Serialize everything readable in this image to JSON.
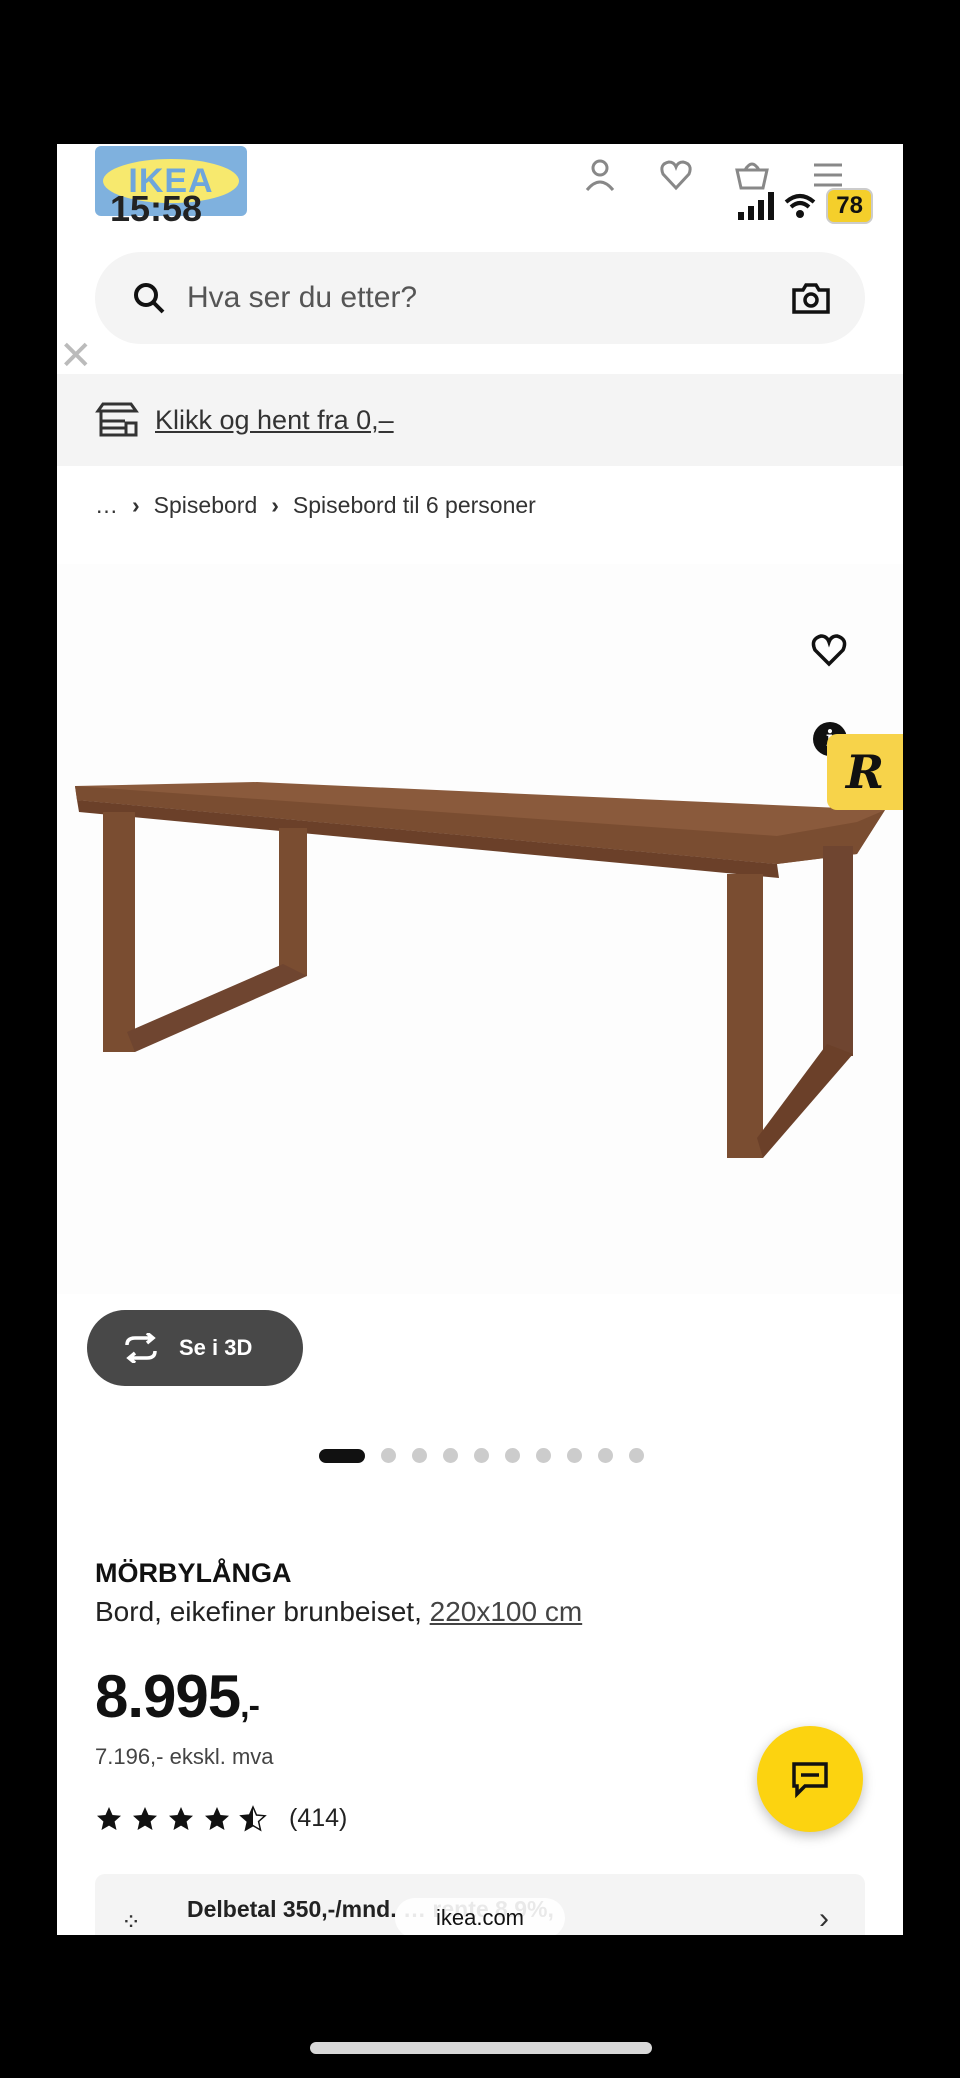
{
  "status_bar": {
    "time": "15:58",
    "battery": "78"
  },
  "header": {
    "logo_text": "IKEA"
  },
  "search": {
    "placeholder": "Hva ser du etter?"
  },
  "click_collect": {
    "label": "Klikk og hent fra 0,–"
  },
  "breadcrumb": {
    "ellipsis": "…",
    "items": [
      "Spisebord",
      "Spisebord til 6 personer"
    ]
  },
  "gallery": {
    "view_3d_label": "Se i 3D",
    "total_images": 11,
    "current_image": 1
  },
  "product": {
    "name": "MÖRBYLÅNGA",
    "description": "Bord, eikefiner brunbeiset,",
    "size": "220x100 cm",
    "price": "8.995",
    "price_suffix": ",-",
    "price_ex_vat": "7.196,- ekskl. mva",
    "rating_stars": 4.5,
    "rating_count": "(414)"
  },
  "installment": {
    "text": "Delbetal 350,-/mnd. … rente 8.9%,"
  },
  "browser": {
    "url": "ikea.com"
  },
  "colors": {
    "ikea_yellow": "#fcd310",
    "ikea_blue": "#7fb1de"
  }
}
